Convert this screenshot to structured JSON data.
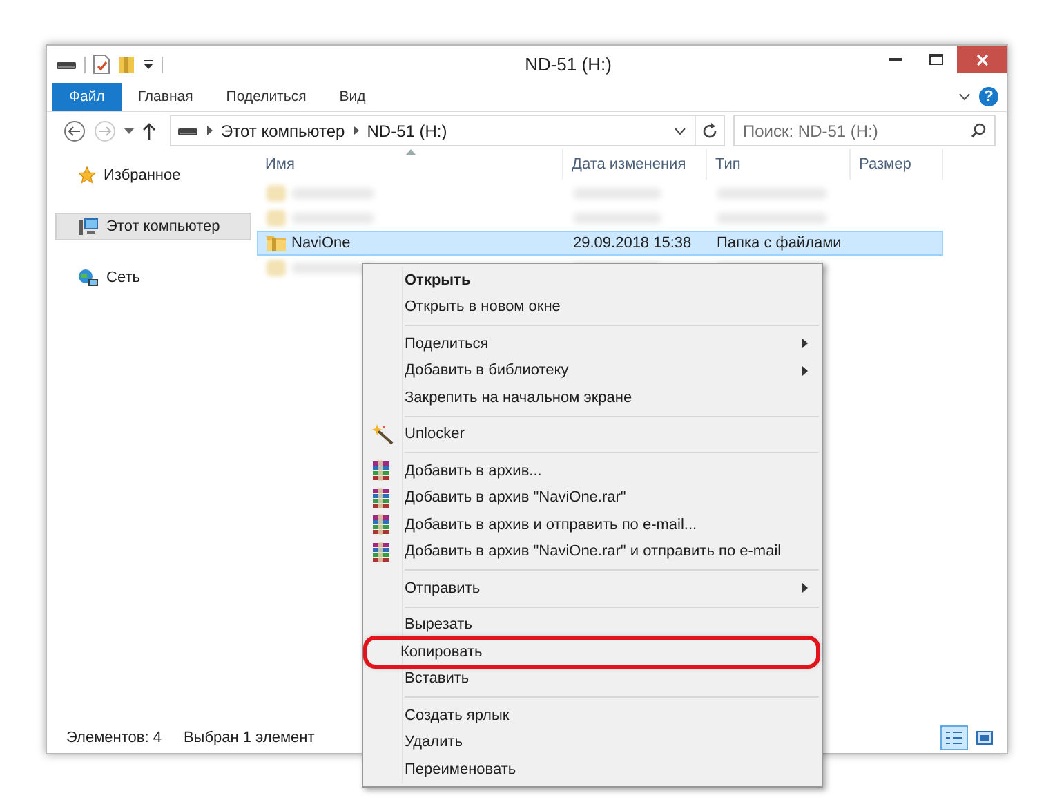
{
  "window": {
    "title": "ND-51 (H:)"
  },
  "ribbon": {
    "tabs": [
      {
        "label": "Файл",
        "selected": true
      },
      {
        "label": "Главная",
        "selected": false
      },
      {
        "label": "Поделиться",
        "selected": false
      },
      {
        "label": "Вид",
        "selected": false
      }
    ],
    "help": "?"
  },
  "address": {
    "crumbs": [
      "Этот компьютер",
      "ND-51 (H:)"
    ],
    "search_placeholder": "Поиск: ND-51 (H:)"
  },
  "sidebar": {
    "items": [
      {
        "kind": "favorites",
        "label": "Избранное",
        "selected": false
      },
      {
        "kind": "computer",
        "label": "Этот компьютер",
        "selected": true
      },
      {
        "kind": "network",
        "label": "Сеть",
        "selected": false
      }
    ]
  },
  "table": {
    "columns": [
      "Имя",
      "Дата изменения",
      "Тип",
      "Размер"
    ],
    "rows": [
      {
        "kind": "blurred",
        "selected": false
      },
      {
        "kind": "blurred",
        "selected": false
      },
      {
        "kind": "file",
        "name": "NaviOne",
        "date": "29.09.2018 15:38",
        "type": "Папка с файлами",
        "selected": true
      },
      {
        "kind": "blurred",
        "selected": false
      }
    ]
  },
  "context_menu": [
    {
      "kind": "item",
      "label": "Открыть",
      "bold": true,
      "submenu": false,
      "highlighted": false
    },
    {
      "kind": "item",
      "label": "Открыть в новом окне",
      "bold": false,
      "submenu": false,
      "highlighted": false
    },
    {
      "kind": "separator"
    },
    {
      "kind": "item",
      "label": "Поделиться",
      "bold": false,
      "submenu": true,
      "highlighted": false
    },
    {
      "kind": "item",
      "label": "Добавить в библиотеку",
      "bold": false,
      "submenu": true,
      "highlighted": false
    },
    {
      "kind": "item",
      "label": "Закрепить на начальном экране",
      "bold": false,
      "submenu": false,
      "highlighted": false
    },
    {
      "kind": "separator"
    },
    {
      "kind": "unlocker",
      "label": "Unlocker",
      "bold": false,
      "submenu": false,
      "highlighted": false
    },
    {
      "kind": "separator"
    },
    {
      "kind": "archive",
      "label": "Добавить в архив...",
      "bold": false,
      "submenu": false,
      "highlighted": false
    },
    {
      "kind": "archive",
      "label": "Добавить в архив \"NaviOne.rar\"",
      "bold": false,
      "submenu": false,
      "highlighted": false
    },
    {
      "kind": "archive",
      "label": "Добавить в архив и отправить по e-mail...",
      "bold": false,
      "submenu": false,
      "highlighted": false
    },
    {
      "kind": "archive",
      "label": "Добавить в архив \"NaviOne.rar\" и отправить по e-mail",
      "bold": false,
      "submenu": false,
      "highlighted": false
    },
    {
      "kind": "separator"
    },
    {
      "kind": "item",
      "label": "Отправить",
      "bold": false,
      "submenu": true,
      "highlighted": false
    },
    {
      "kind": "separator"
    },
    {
      "kind": "item",
      "label": "Вырезать",
      "bold": false,
      "submenu": false,
      "highlighted": false
    },
    {
      "kind": "item",
      "label": "Копировать",
      "bold": false,
      "submenu": false,
      "highlighted": true
    },
    {
      "kind": "item",
      "label": "Вставить",
      "bold": false,
      "submenu": false,
      "highlighted": false
    },
    {
      "kind": "separator"
    },
    {
      "kind": "item",
      "label": "Создать ярлык",
      "bold": false,
      "submenu": false,
      "highlighted": false
    },
    {
      "kind": "item",
      "label": "Удалить",
      "bold": false,
      "submenu": false,
      "highlighted": false
    },
    {
      "kind": "item",
      "label": "Переименовать",
      "bold": false,
      "submenu": false,
      "highlighted": false
    }
  ],
  "status_bar": {
    "count": "Элементов: 4",
    "selection": "Выбран 1 элемент",
    "views": [
      {
        "kind": "details",
        "selected": true
      },
      {
        "kind": "tiles",
        "selected": false
      }
    ]
  }
}
